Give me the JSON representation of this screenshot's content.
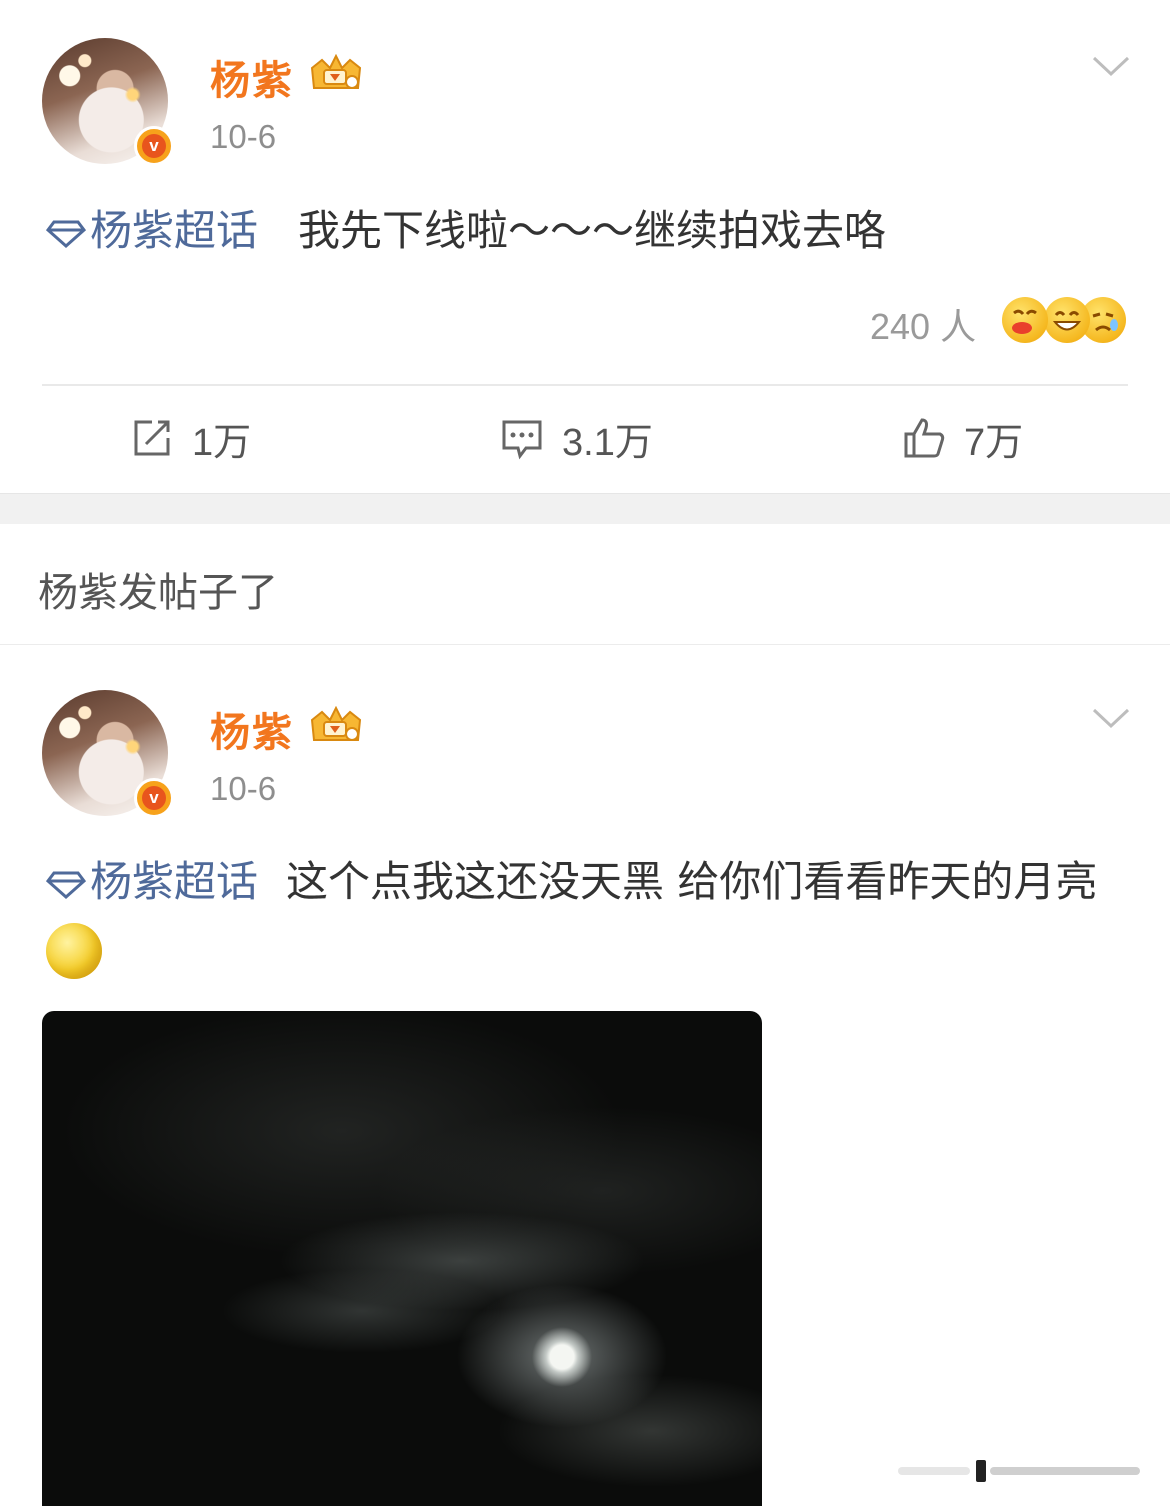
{
  "post1": {
    "author": "杨紫",
    "date": "10-6",
    "topic": "杨紫超话",
    "text": "我先下线啦～～～继续拍戏去咯",
    "reaction_count": "240 人",
    "reaction_icons": [
      "kiss-face-icon",
      "grin-face-icon",
      "sad-face-icon"
    ],
    "actions": {
      "repost": "1万",
      "comment": "3.1万",
      "like": "7万"
    }
  },
  "section": {
    "title": "杨紫发帖子了"
  },
  "post2": {
    "author": "杨紫",
    "date": "10-6",
    "topic": "杨紫超话",
    "text": "这个点我这还没天黑 给你们看看昨天的月亮",
    "emoji": "moon-emoji-icon",
    "image": "night-sky-moon-photo"
  },
  "colors": {
    "name": "#f2761e",
    "topic": "#4f6a9a",
    "verified": "#f7a21b"
  }
}
